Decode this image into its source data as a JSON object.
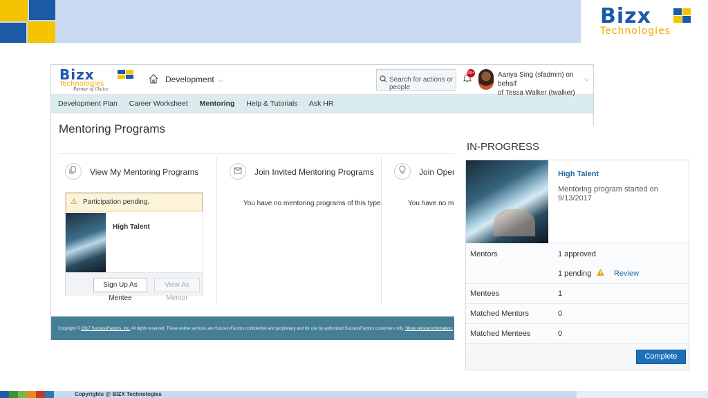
{
  "slide": {
    "brand_name": "Bizx",
    "brand_sub": "Technologies",
    "copyright": "Copyrights @ BIZX Technologies",
    "colors": {
      "band": "#c9daf0",
      "blue": "#1c5aa6",
      "yellow": "#f5c400"
    }
  },
  "app": {
    "logo": {
      "name": "Bizx",
      "sub": "Technologies",
      "tagline": "Partner of Choice"
    },
    "home_icon": "home-icon",
    "module": "Development",
    "search_placeholder": "Search for actions or people",
    "notifications_badge": "99+",
    "user_line1": "Aanya Sing (sfadmin) on behalf",
    "user_line2": "of Tessa Walker (twalker)",
    "subnav": [
      "Development Plan",
      "Career Worksheet",
      "Mentoring",
      "Help & Tutorials",
      "Ask HR"
    ],
    "subnav_active": "Mentoring",
    "page_title": "Mentoring Programs",
    "columns": [
      {
        "icon": "document-icon",
        "title": "View My Mentoring Programs"
      },
      {
        "icon": "envelope-icon",
        "title": "Join Invited Mentoring Programs",
        "empty": "You have no mentoring programs of this type."
      },
      {
        "icon": "lightbulb-icon",
        "title": "Join Open M",
        "empty": "You have no mentorir"
      }
    ],
    "program_card": {
      "pending": "Participation pending.",
      "name": "High Talent",
      "btn_mentee": "Sign Up As Mentee",
      "btn_mentor": "View As Mentor"
    },
    "footer": {
      "prefix": "Copyright ©",
      "year_link": "2017 SuccessFactors, Inc.",
      "middle": "All rights reserved. These online services are SuccessFactors confidential and proprietary and for use by authorized SuccessFactors customers only.",
      "version_link": "Show version information."
    }
  },
  "panel": {
    "heading": "IN-PROGRESS",
    "title": "High Talent",
    "description": "Mentoring program started on 9/13/2017",
    "rows": {
      "mentors_label": "Mentors",
      "mentors_approved": "1 approved",
      "mentors_pending": "1 pending",
      "review": "Review",
      "mentees_label": "Mentees",
      "mentees_value": "1",
      "matched_mentors_label": "Matched Mentors",
      "matched_mentors_value": "0",
      "matched_mentees_label": "Matched Mentees",
      "matched_mentees_value": "0"
    },
    "complete_button": "Complete"
  }
}
